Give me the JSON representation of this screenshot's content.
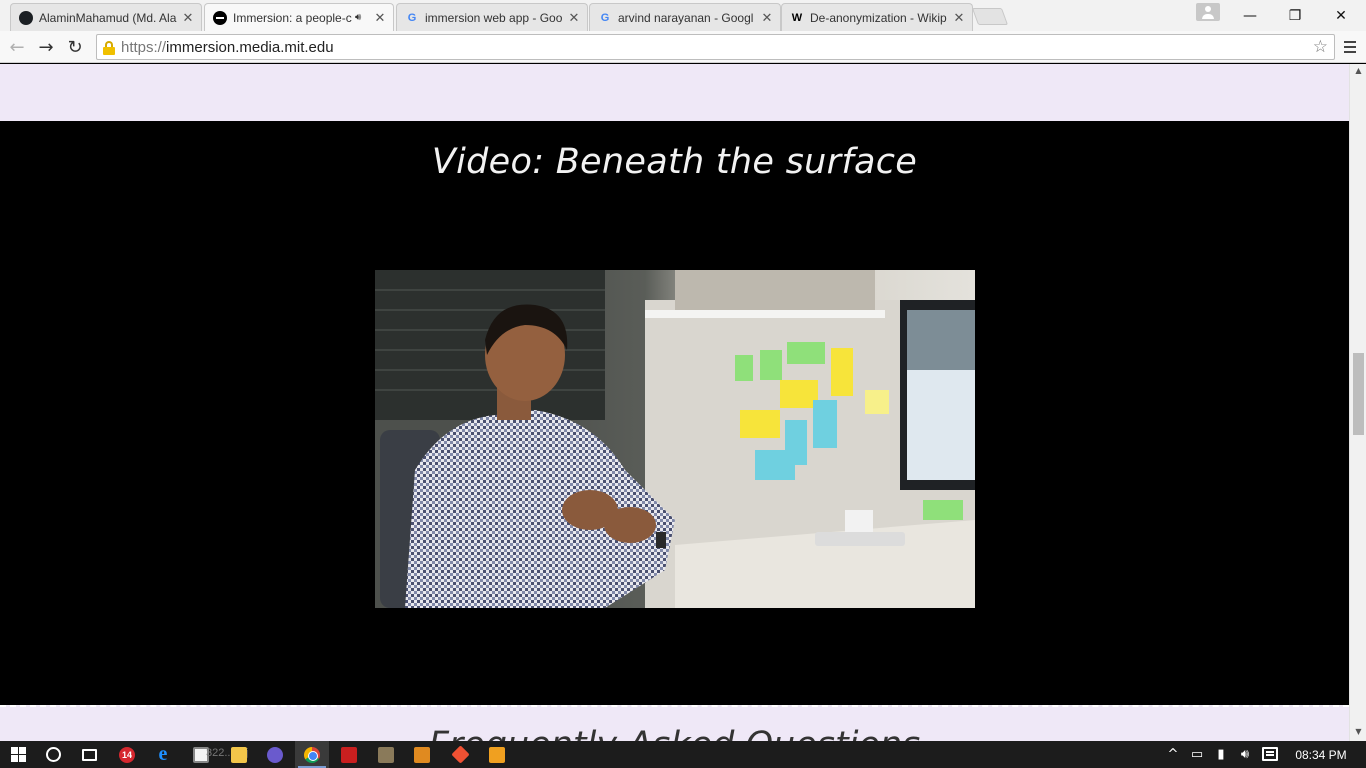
{
  "browser": {
    "tabs": [
      {
        "title": "AlaminMahamud (Md. Ala",
        "favicon": "github-icon",
        "active": false
      },
      {
        "title": "Immersion: a people-ce",
        "favicon": "immersion-icon",
        "active": true,
        "audio": true
      },
      {
        "title": "immersion web app - Goo",
        "favicon": "google-icon",
        "active": false
      },
      {
        "title": "arvind narayanan - Googl",
        "favicon": "google-icon",
        "active": false
      },
      {
        "title": "De-anonymization - Wikip",
        "favicon": "wikipedia-icon",
        "active": false
      }
    ],
    "url_scheme": "https://",
    "url_host": "immersion.media.mit.edu"
  },
  "page": {
    "video_title": "Video: Beneath the surface",
    "next_section_title": "Frequently Asked Questions"
  },
  "taskbar": {
    "badge_count": "14",
    "faint_label": "322.. obj",
    "clock": "08:34 PM"
  },
  "colors": {
    "section_band": "#efe8f7",
    "page_background": "#000000",
    "taskbar": "#1c1c1c"
  }
}
